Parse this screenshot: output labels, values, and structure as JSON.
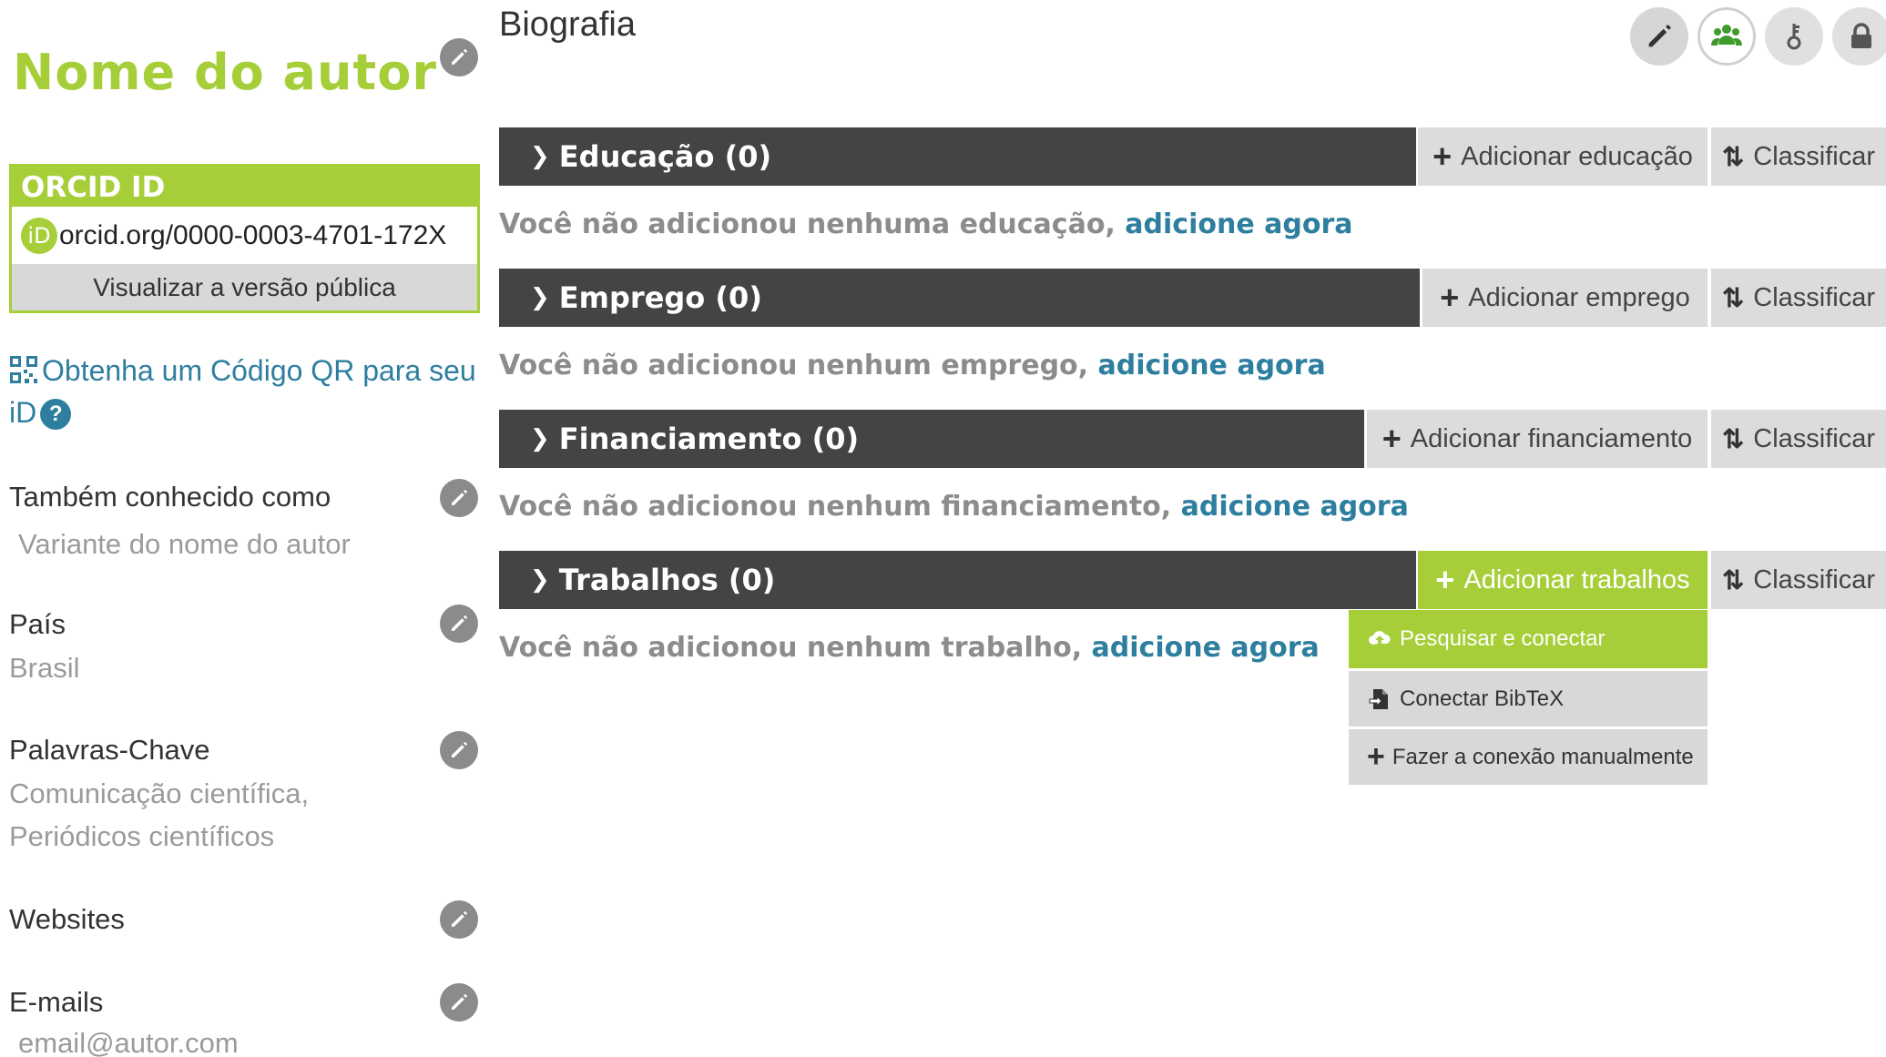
{
  "sidebar": {
    "author_name": "Nome do autor",
    "orcid": {
      "header": "ORCID ID",
      "badge": "iD",
      "id": "orcid.org/0000-0003-4701-172X",
      "public_link": "Visualizar a versão pública"
    },
    "qr_link": "Obtenha um Código QR para seu iD",
    "help_glyph": "?",
    "also_known": {
      "label": "Também conhecido como",
      "value": "Variante do nome do autor"
    },
    "country": {
      "label": "País",
      "value": "Brasil"
    },
    "keywords": {
      "label": "Palavras-Chave",
      "value_line1": "Comunicação científica,",
      "value_line2": "Periódicos científicos"
    },
    "websites": {
      "label": "Websites"
    },
    "emails": {
      "label": "E-mails",
      "value": "email@autor.com"
    }
  },
  "main": {
    "bio_title": "Biografia",
    "toolbar": [
      "pencil-icon",
      "users-icon",
      "key-icon",
      "lock-icon"
    ],
    "sections": [
      {
        "title": "Educação (0)",
        "add_label": "Adicionar educação",
        "sort_label": "Classificar",
        "empty_text": "Você não adicionou nenhuma educação,",
        "empty_link": "adicione agora"
      },
      {
        "title": "Emprego (0)",
        "add_label": "Adicionar emprego",
        "sort_label": "Classificar",
        "empty_text": "Você não adicionou nenhum emprego,",
        "empty_link": "adicione agora"
      },
      {
        "title": "Financiamento (0)",
        "add_label": "Adicionar financiamento",
        "sort_label": "Classificar",
        "empty_text": "Você não adicionou nenhum financiamento,",
        "empty_link": "adicione agora"
      },
      {
        "title": "Trabalhos (0)",
        "add_label": "Adicionar trabalhos",
        "sort_label": "Classificar",
        "empty_text": "Você não adicionou nenhum trabalho,",
        "empty_link": "adicione agora"
      }
    ],
    "works_menu": [
      "Pesquisar e conectar",
      "Conectar BibTeX",
      "Fazer a conexão manualmente"
    ]
  },
  "colors": {
    "accent": "#a6ce39",
    "link": "#2e7f9f",
    "bar": "#444445"
  }
}
